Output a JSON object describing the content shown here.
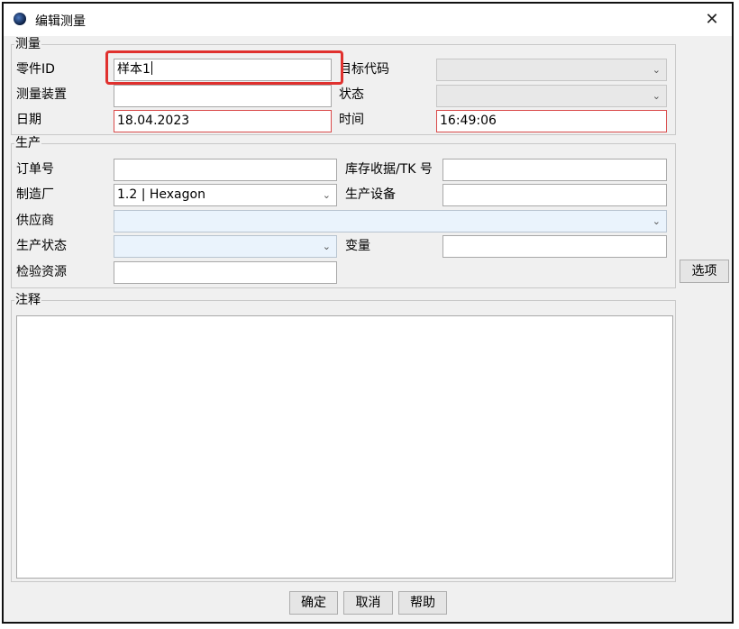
{
  "window": {
    "title": "编辑测量",
    "close_glyph": "✕"
  },
  "measurement": {
    "legend": "测量",
    "part_id_label": "零件ID",
    "part_id_value": "样本1",
    "target_code_label": "目标代码",
    "target_code_value": "",
    "device_label": "测量装置",
    "device_value": "",
    "status_label": "状态",
    "status_value": "",
    "date_label": "日期",
    "date_value": "18.04.2023",
    "time_label": "时间",
    "time_value": "16:49:06"
  },
  "production": {
    "legend": "生产",
    "order_label": "订单号",
    "order_value": "",
    "stock_label": "库存收据/TK 号",
    "stock_value": "",
    "manufacturer_label": "制造厂",
    "manufacturer_value": "1.2 | Hexagon",
    "equipment_label": "生产设备",
    "equipment_value": "",
    "supplier_label": "供应商",
    "supplier_value": "",
    "prod_status_label": "生产状态",
    "prod_status_value": "",
    "variable_label": "变量",
    "variable_value": "",
    "inspection_label": "检验资源",
    "inspection_value": ""
  },
  "notes": {
    "legend": "注释",
    "value": ""
  },
  "buttons": {
    "options": "选项",
    "ok": "确定",
    "cancel": "取消",
    "help": "帮助"
  },
  "icons": {
    "dropdown": "chevron-down-icon",
    "app": "app-icon",
    "close": "close-icon"
  },
  "colors": {
    "required_border": "#d94a4a",
    "highlight": "#e0312e",
    "supplier_bg": "#eaf3fc"
  }
}
